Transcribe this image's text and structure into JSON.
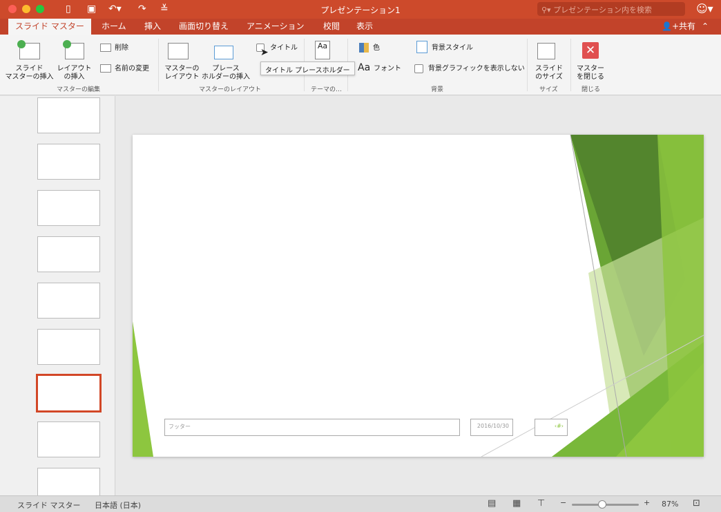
{
  "window": {
    "title": "プレゼンテーション1",
    "search_placeholder": "プレゼンテーション内を検索"
  },
  "tabs": [
    {
      "label": "スライド マスター",
      "active": true
    },
    {
      "label": "ホーム"
    },
    {
      "label": "挿入"
    },
    {
      "label": "画面切り替え"
    },
    {
      "label": "アニメーション"
    },
    {
      "label": "校閲"
    },
    {
      "label": "表示"
    }
  ],
  "share_label": "共有",
  "ribbon": {
    "insert_master": "スライド\nマスターの挿入",
    "insert_layout": "レイアウト\nの挿入",
    "delete": "削除",
    "rename": "名前の変更",
    "group_edit": "マスターの編集",
    "master_layout": "マスターの\nレイアウト",
    "insert_placeholder": "プレース\nホルダーの挿入",
    "title_checkbox": "タイトル",
    "group_layout": "マスターのレイアウト",
    "themes_group": "テーマの…",
    "colors": "色",
    "fonts": "フォント",
    "bg_styles": "背景スタイル",
    "hide_bg": "背景グラフィックを表示しない",
    "group_bg": "背景",
    "slide_size": "スライド\nのサイズ",
    "group_size": "サイズ",
    "close_master": "マスター\nを閉じる",
    "group_close": "閉じる"
  },
  "tooltip": "タイトル プレースホルダー",
  "slide": {
    "footer": "フッター",
    "date": "2016/10/30",
    "page": "‹#›"
  },
  "status": {
    "view": "スライド マスター",
    "language": "日本語 (日本)",
    "zoom": "87%",
    "zoom_minus": "−",
    "zoom_plus": "+",
    "zoom_level": 0.45
  },
  "colors": {
    "accent": "#c2432a",
    "green_dark": "#5a8f2a",
    "green_light": "#8dc63f",
    "selected": "#d24726"
  }
}
